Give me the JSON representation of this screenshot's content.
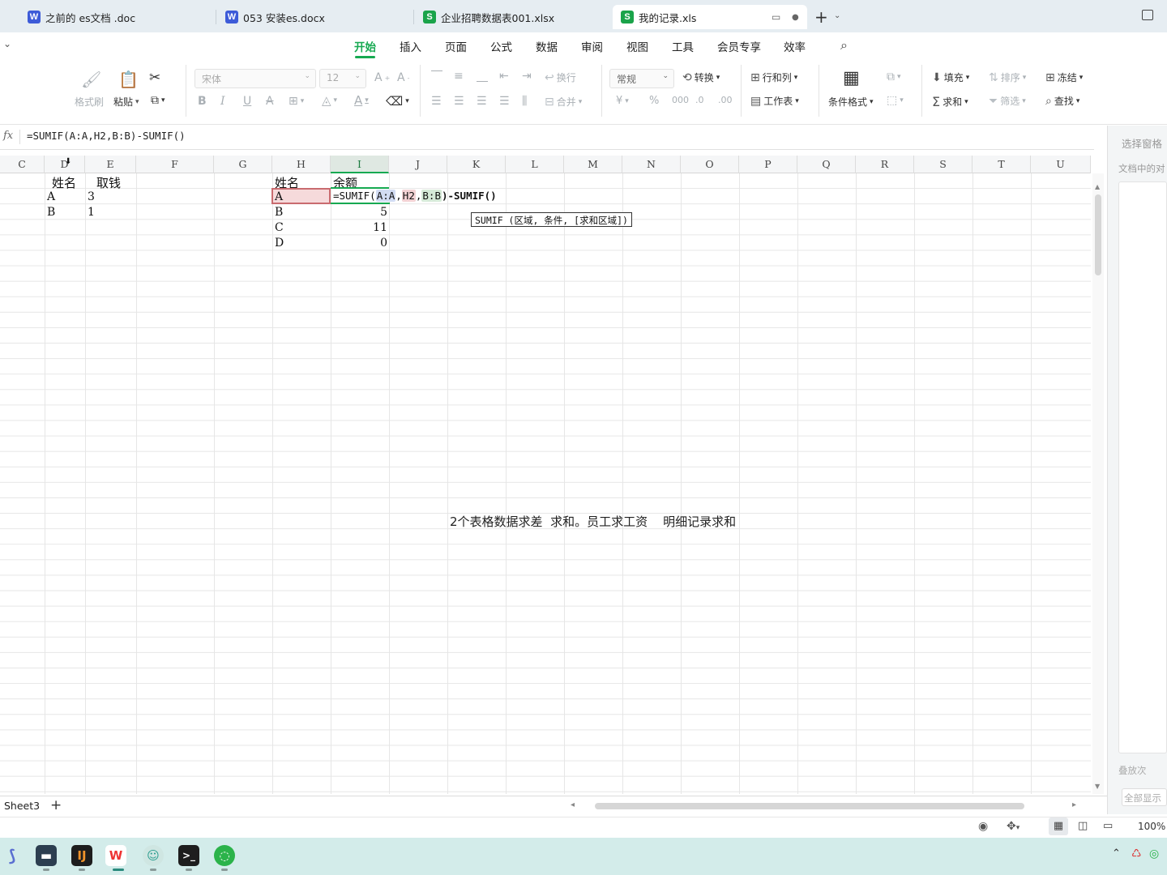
{
  "tabs": [
    {
      "label": "之前的 es文档 .doc",
      "icon": "W",
      "color": "#3d5bd8"
    },
    {
      "label": "053 安装es.docx",
      "icon": "W",
      "color": "#3d5bd8"
    },
    {
      "label": "企业招聘数据表001.xlsx",
      "icon": "S",
      "color": "#1aa34a"
    },
    {
      "label": "我的记录.xls",
      "icon": "S",
      "color": "#1aa34a"
    }
  ],
  "ribbon_tabs": [
    "开始",
    "插入",
    "页面",
    "公式",
    "数据",
    "审阅",
    "视图",
    "工具",
    "会员专享",
    "效率"
  ],
  "toolbar": {
    "format_painter": "格式刷",
    "paste": "粘贴",
    "font_name": "宋体",
    "font_size": "12",
    "wrap": "换行",
    "merge": "合并",
    "number_format": "常规",
    "convert": "转换",
    "rows_cols": "行和列",
    "worksheet": "工作表",
    "cond_format": "条件格式",
    "fill": "填充",
    "sort": "排序",
    "freeze": "冻结",
    "sum": "求和",
    "filter": "筛选",
    "find": "查找"
  },
  "formula_bar": {
    "fx": "fx",
    "formula": "=SUMIF(A:A,H2,B:B)-SUMIF()"
  },
  "columns": [
    "C",
    "D",
    "E",
    "F",
    "G",
    "H",
    "I",
    "J",
    "K",
    "L",
    "M",
    "N",
    "O",
    "P",
    "Q",
    "R",
    "S",
    "T",
    "U"
  ],
  "cells": {
    "D1": "姓名",
    "E1": "取钱",
    "D2": "A",
    "E2": "3",
    "D3": "B",
    "E3": "1",
    "H1": "姓名",
    "I1": "余额",
    "H2": "A",
    "H3": "B",
    "I3": "5",
    "H4": "C",
    "I4": "11",
    "H5": "D",
    "I5": "0"
  },
  "editing": {
    "prefix": "=SUMIF(",
    "ref1": "A:A",
    "ref2": "H2",
    "ref3": "B:B",
    "suffix": ")-SUMIF()"
  },
  "tooltip": "SUMIF (区域, 条件, [求和区域])",
  "caption": "2个表格数据求差  求和。员工求工资    明细记录求和",
  "right_pane": {
    "title": "选择窗格",
    "subtitle": "文档中的对",
    "b1": "叠放次",
    "b2": "全部显示"
  },
  "sheet_tab": "Sheet3",
  "zoom": "100%"
}
